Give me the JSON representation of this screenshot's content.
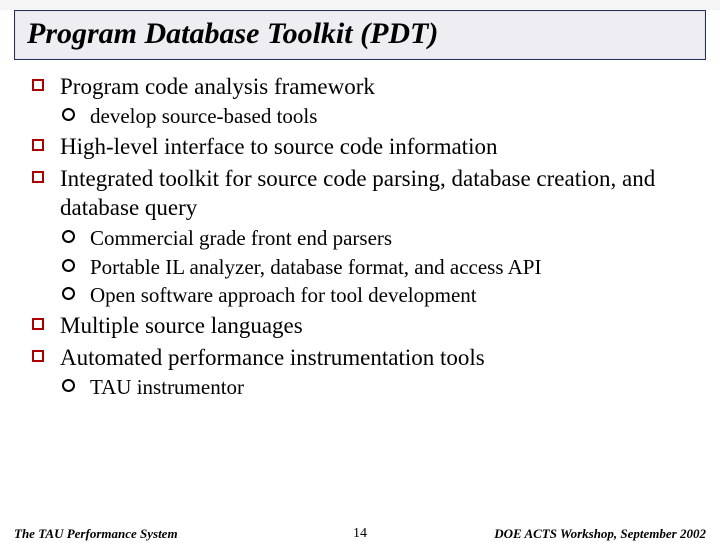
{
  "title": "Program Database Toolkit (PDT)",
  "bullets": {
    "b1": "Program code analysis framework",
    "b1_1": "develop source-based tools",
    "b2": "High-level interface to source code information",
    "b3": "Integrated toolkit for source code parsing, database creation, and database query",
    "b3_1": "Commercial grade front end parsers",
    "b3_2": "Portable IL analyzer, database format, and access API",
    "b3_3": "Open software approach for tool development",
    "b4": "Multiple source languages",
    "b5": "Automated performance instrumentation tools",
    "b5_1": "TAU instrumentor"
  },
  "footer": {
    "left": "The TAU Performance System",
    "center": "14",
    "right": "DOE ACTS Workshop, September 2002"
  }
}
